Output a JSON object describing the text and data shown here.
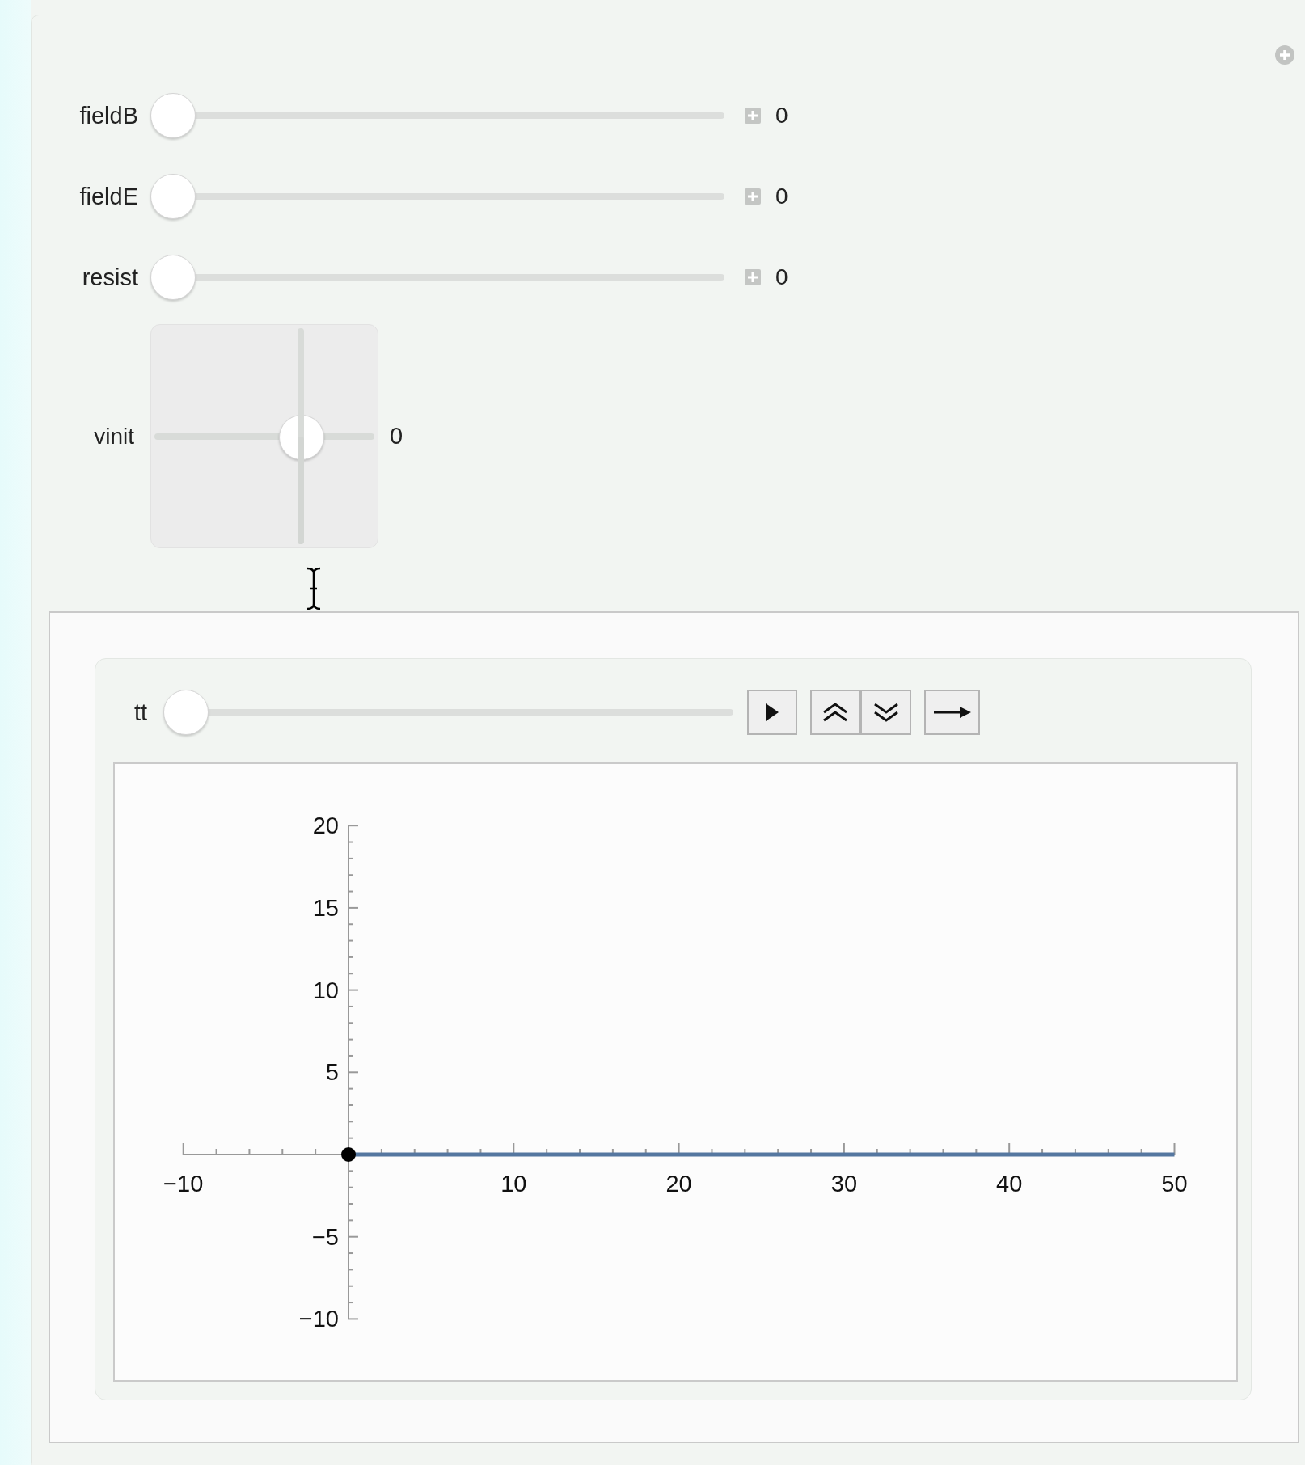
{
  "sliders": [
    {
      "label": "fieldB",
      "level": 0,
      "value": "0"
    },
    {
      "label": "fieldE",
      "level": 0,
      "value": "0"
    },
    {
      "label": "resist",
      "level": 0,
      "value": "0"
    }
  ],
  "pad": {
    "label": "vinit",
    "x": {
      "level": 0.7
    },
    "y": {
      "level": 0.5
    },
    "value": "0"
  },
  "animator": {
    "label": "tt",
    "level": 0,
    "buttons": [
      {
        "kind": "play"
      },
      {
        "kind": "faster"
      },
      {
        "kind": "slower"
      },
      {
        "kind": "direction"
      }
    ],
    "chart_data": {
      "type": "line",
      "x": [
        0,
        50
      ],
      "series": [
        {
          "color": "#5577a0",
          "values": [
            0,
            0
          ]
        }
      ],
      "xlim": [
        -10,
        50
      ],
      "ylim": [
        -10,
        20
      ],
      "xticks": [
        {
          "value": -10,
          "label": "−10"
        },
        10,
        20,
        30,
        40,
        50
      ],
      "yticks": [
        {
          "value": -10,
          "label": "−10"
        },
        {
          "value": -5,
          "label": "−5"
        },
        5,
        10,
        15,
        20
      ]
    }
  }
}
